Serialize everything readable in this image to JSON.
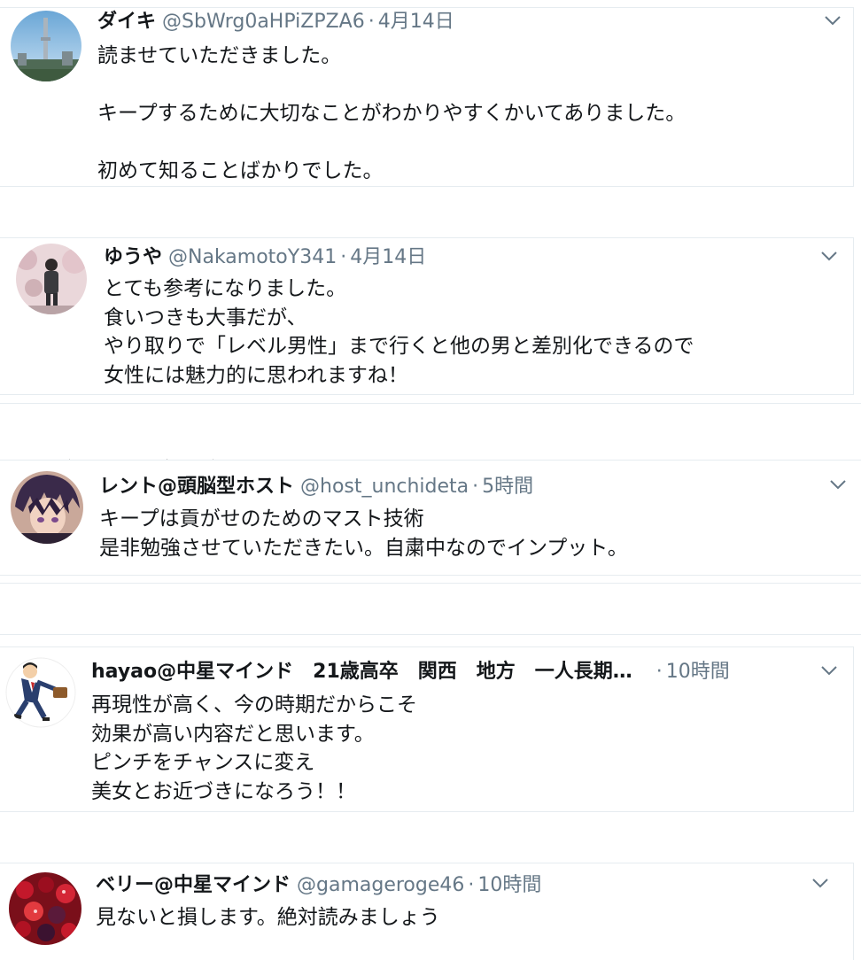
{
  "tweets": [
    {
      "name": "ダイキ",
      "handle": "@SbWrg0aHPiZPZA6",
      "time": "4月14日",
      "lines": [
        "読ませていただきました。",
        "",
        "キープするために大切なことがわかりやすくかいてありました。",
        "",
        "初めて知ることばかりでした。"
      ],
      "avatar": "tower-avatar"
    },
    {
      "name": "ゆうや",
      "handle": "@NakamotoY341",
      "time": "4月14日",
      "lines": [
        "とても参考になりました。",
        "食いつきも大事だが、",
        "やり取りで「レベル男性」まで行くと他の男と差別化できるので",
        "女性には魅力的に思われますね！"
      ],
      "avatar": "person-blossom-avatar"
    },
    {
      "name": "レント@頭脳型ホスト",
      "handle": "@host_unchideta",
      "time": "5時間",
      "lines": [
        "キープは貢がせのためのマスト技術",
        "是非勉強させていただきたい。自粛中なのでインプット。"
      ],
      "avatar": "anime-avatar"
    },
    {
      "name": "hayao@中星マインド　21歳高卒　関西　地方　一人長期…",
      "handle": "",
      "time": "10時間",
      "lines": [
        "再現性が高く、今の時期だからこそ",
        "効果が高い内容だと思います。",
        "ピンチをチャンスに変え",
        "美女とお近づきになろう！！"
      ],
      "avatar": "businessman-avatar"
    },
    {
      "name": "ベリー@中星マインド",
      "handle": "@gamageroge46",
      "time": "10時間",
      "lines": [
        "見ないと損します。絶対読みましょう"
      ],
      "avatar": "berries-avatar"
    }
  ],
  "separator": "·",
  "icons": {
    "more": "chevron-down-icon"
  },
  "colors": {
    "name": "#14171a",
    "meta": "#657786",
    "border": "#e6ecf0"
  }
}
